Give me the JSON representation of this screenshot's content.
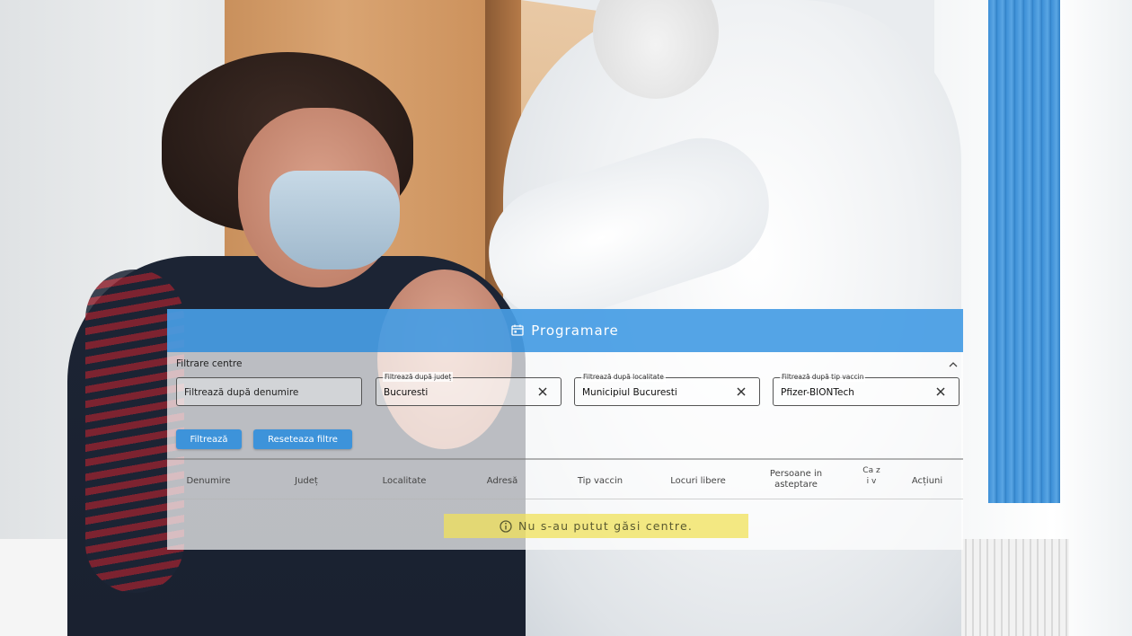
{
  "panel": {
    "title": "Programare",
    "accent_color": "#479de4"
  },
  "filters": {
    "section_label": "Filtrare centre",
    "name_field": {
      "placeholder": "Filtrează după denumire"
    },
    "county_field": {
      "label": "Filtrează după județ",
      "value": "Bucuresti"
    },
    "locality_field": {
      "label": "Filtrează după localitate",
      "value": "Municipiul Bucuresti"
    },
    "vaccine_field": {
      "label": "Filtrează după tip vaccin",
      "value": "Pfizer-BIONTech"
    },
    "filter_button": "Filtrează",
    "reset_button": "Reseteaza filtre"
  },
  "table": {
    "columns": [
      "Denumire",
      "Județ",
      "Localitate",
      "Adresă",
      "Tip vaccin",
      "Locuri libere",
      "Persoane in asteptare",
      "Ca zi v",
      "Acțiuni"
    ],
    "empty_message": "Nu s-au putut găsi centre."
  },
  "icons": {
    "header": "calendar-icon",
    "collapse": "chevron-up-icon",
    "clear": "close-icon",
    "alert": "info-icon"
  }
}
